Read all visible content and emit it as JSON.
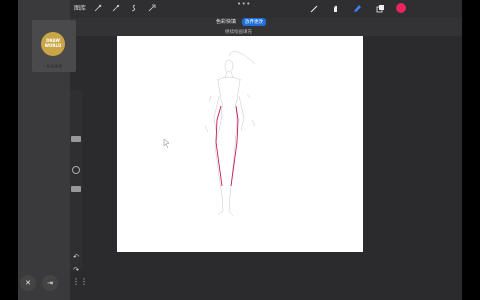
{
  "topbar": {
    "gallery_label": "图库",
    "menu_dots": "•••",
    "color_swatch": "#e8245a"
  },
  "document": {
    "title": "色彩快填",
    "badge": "放弃更改",
    "subtitle": "继续绘画填充"
  },
  "thumbnail": {
    "logo_text": "DRAW WORLD",
    "caption": "一 起 画 画 吧"
  },
  "sidebar": {
    "undo": "↶",
    "redo": "↷"
  },
  "bottom": {
    "close": "✕",
    "exit": "⇥",
    "grid": "⋮⋮"
  }
}
